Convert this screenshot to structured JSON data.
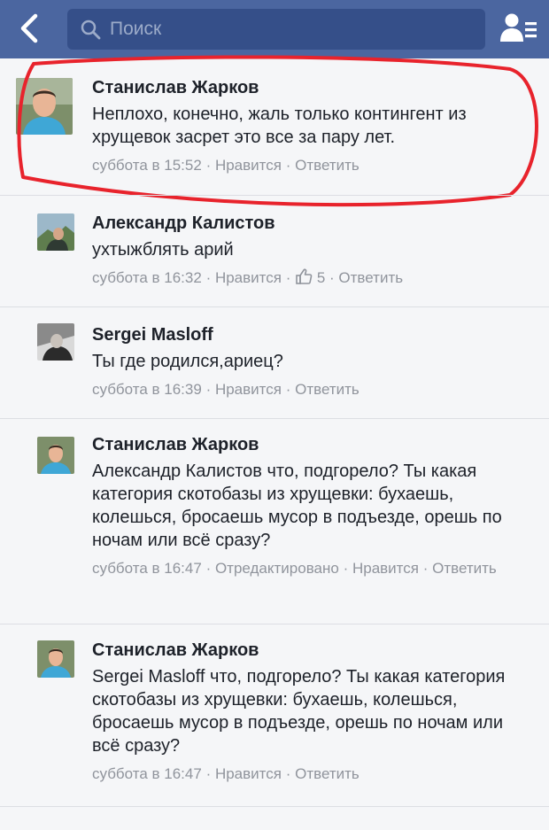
{
  "search": {
    "placeholder": "Поиск"
  },
  "icons": {
    "back": "chevron-left-icon",
    "search": "magnifier-icon",
    "friends": "friend-requests-icon",
    "like": "thumbs-up-icon"
  },
  "colors": {
    "header": "#4b66a0",
    "search_box": "#354f89",
    "meta_text": "#90949c",
    "annotation": "#e8232c"
  },
  "comments": [
    {
      "author": "Станислав Жарков",
      "text": "Неплохо, конечно, жаль только контингент из хрущевок засрет это все за пару лет.",
      "time": "суббота в 15:52",
      "like": "Нравится",
      "reply": "Ответить"
    },
    {
      "author": "Александр Калистов",
      "text": "ухтыжблять арий",
      "time": "суббота в 16:32",
      "like": "Нравится",
      "likes_count": "5",
      "reply": "Ответить"
    },
    {
      "author": "Sergei Masloff",
      "text": "Ты где родился,ариец?",
      "time": "суббота в 16:39",
      "like": "Нравится",
      "reply": "Ответить"
    },
    {
      "author": "Станислав Жарков",
      "text": "Александр Калистов что, подгорело? Ты какая категория скотобазы из хрущевки: бухаешь, колешься, бросаешь мусор в подъезде, орешь по ночам или всё сразу?",
      "time": "суббота в 16:47",
      "edited": "Отредактировано",
      "like": "Нравится",
      "reply": "Ответить"
    },
    {
      "author": "Станислав Жарков",
      "text": "Sergei Masloff что, подгорело? Ты какая категория скотобазы из хрущевки: бухаешь, колешься, бросаешь мусор в подъезде, орешь по ночам или всё сразу?",
      "time": "суббота в 16:47",
      "like": "Нравится",
      "reply": "Ответить"
    }
  ]
}
